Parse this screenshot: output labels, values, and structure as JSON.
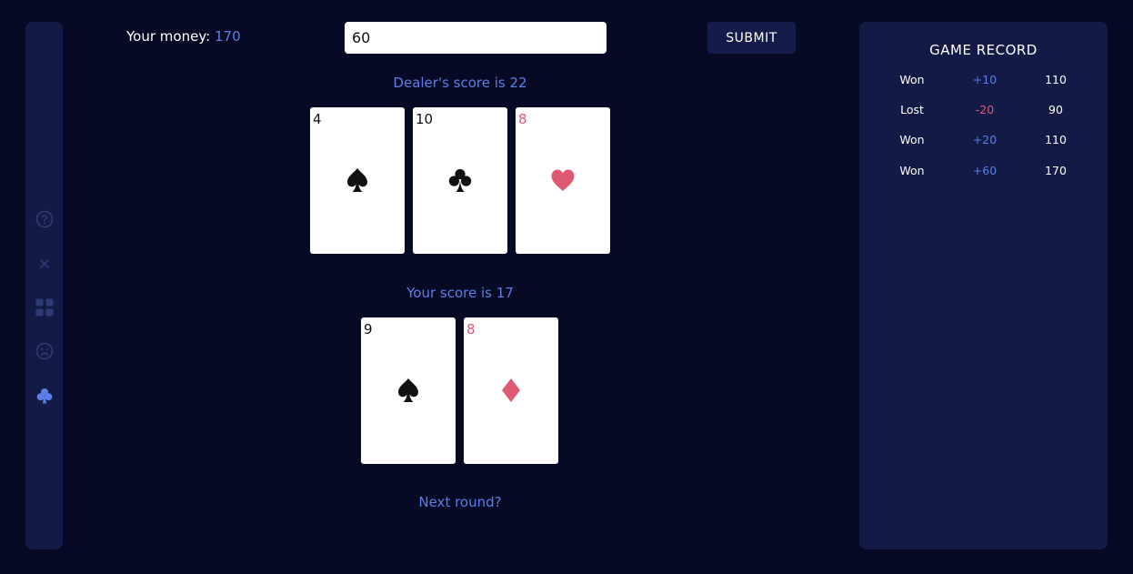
{
  "money": {
    "label": "Your money:",
    "value": "170"
  },
  "bet": {
    "value": "60"
  },
  "submit_label": "SUBMIT",
  "dealer": {
    "score_text": "Dealer's score is 22",
    "cards": [
      {
        "rank": "4",
        "suit": "spade",
        "color": "black"
      },
      {
        "rank": "10",
        "suit": "club",
        "color": "black"
      },
      {
        "rank": "8",
        "suit": "heart",
        "color": "red"
      }
    ]
  },
  "player": {
    "score_text": "Your score is 17",
    "cards": [
      {
        "rank": "9",
        "suit": "spade",
        "color": "black"
      },
      {
        "rank": "8",
        "suit": "diamond",
        "color": "red"
      }
    ]
  },
  "next_round_label": "Next round?",
  "sidebar": {
    "icons": [
      "help-icon",
      "close-icon",
      "grid-icon",
      "sad-face-icon",
      "club-icon"
    ]
  },
  "record": {
    "title": "GAME RECORD",
    "rows": [
      {
        "result": "Won",
        "change": "+10",
        "total": "110"
      },
      {
        "result": "Lost",
        "change": "-20",
        "total": "90"
      },
      {
        "result": "Won",
        "change": "+20",
        "total": "110"
      },
      {
        "result": "Won",
        "change": "+60",
        "total": "170"
      }
    ]
  },
  "colors": {
    "background": "#070a25",
    "panel": "#131a45",
    "accent": "#5b7fe6",
    "red_suit": "#dd5a72"
  }
}
